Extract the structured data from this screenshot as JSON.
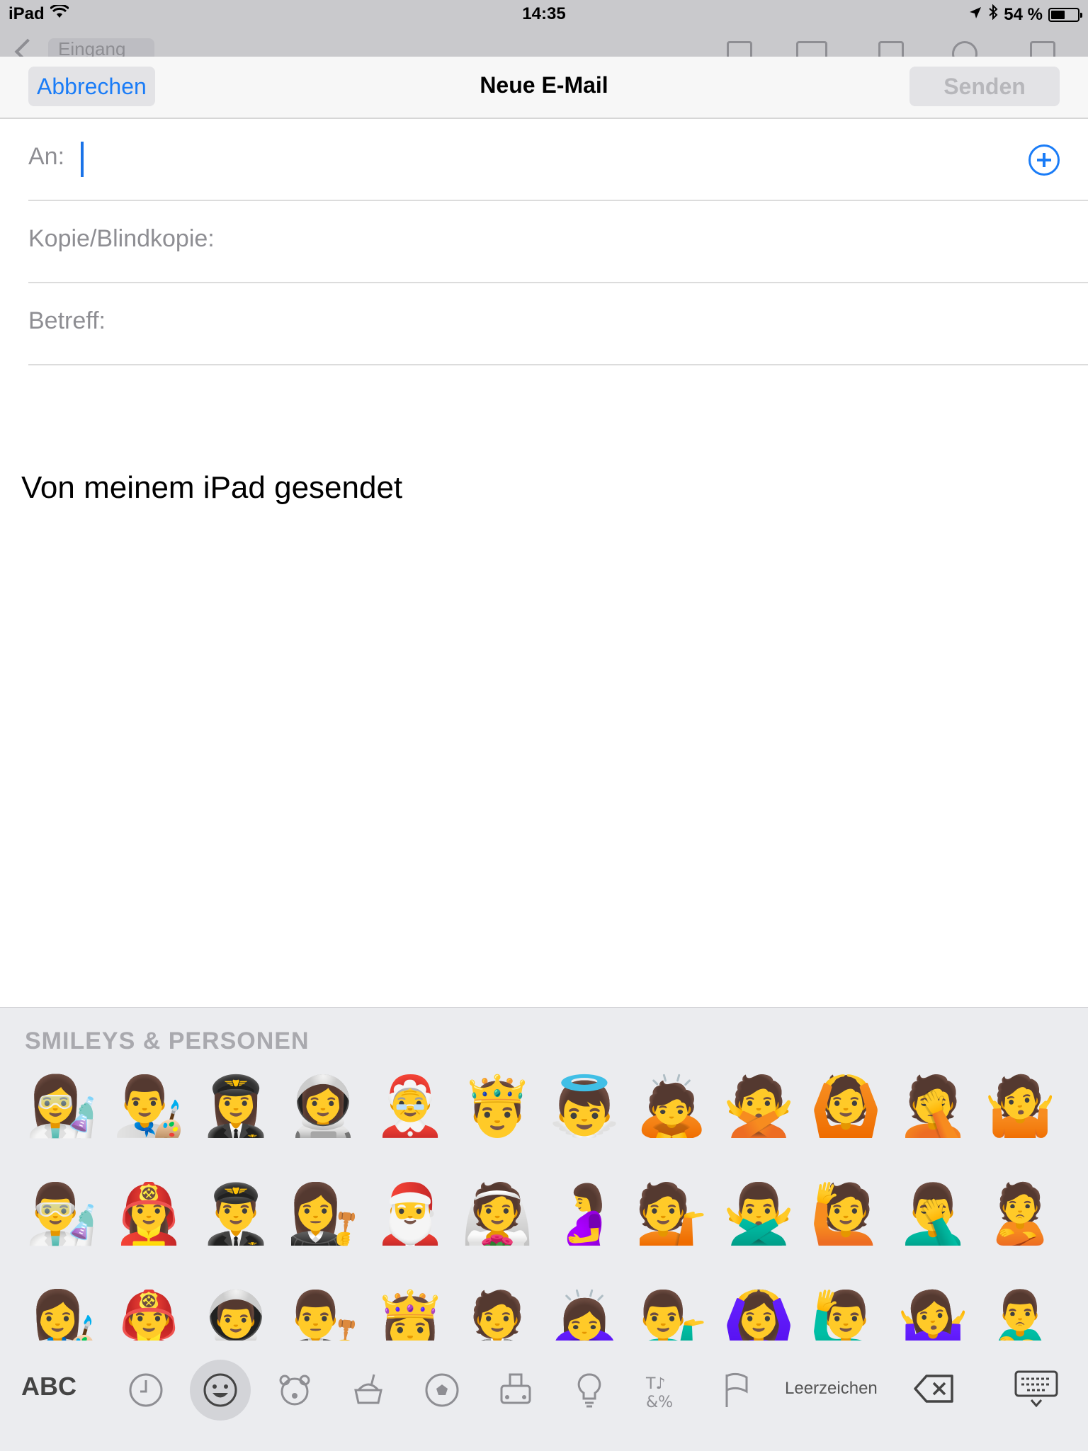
{
  "status_bar": {
    "device": "iPad",
    "time": "14:35",
    "battery": "54 %",
    "battery_level": 0.54
  },
  "background_toolbar": {
    "back_label": "Eingang"
  },
  "compose": {
    "cancel_label": "Abbrechen",
    "title": "Neue E-Mail",
    "send_label": "Senden",
    "to_label": "An:",
    "cc_label": "Kopie/Blindkopie:",
    "subject_label": "Betreff:",
    "signature": "Von meinem iPad gesendet"
  },
  "keyboard": {
    "category_title": "SMILEYS & PERSONEN",
    "abc_label": "ABC",
    "space_label": "Leerzeichen",
    "emoji_rows": [
      [
        "👩‍🔬",
        "👨‍🎨",
        "👩‍✈️",
        "👩‍🚀",
        "🤶",
        "🤴",
        "👼",
        "🙇",
        "🙅",
        "🙆",
        "🤦",
        "🤷"
      ],
      [
        "👨‍🔬",
        "👩‍🚒",
        "👨‍✈️",
        "👩‍⚖️",
        "🎅",
        "👰",
        "🤰",
        "💁",
        "🙅‍♂️",
        "🙋",
        "🤦‍♂️",
        "🙎"
      ],
      [
        "👩‍🎨",
        "👨‍🚒",
        "👨‍🚀",
        "👨‍⚖️",
        "👸",
        "🤵",
        "🙇‍♀️",
        "💁‍♂️",
        "🙆‍♀️",
        "🙋‍♂️",
        "🤷‍♀️",
        "🙎‍♂️"
      ]
    ],
    "categories": [
      "recent-icon",
      "smileys-icon",
      "animals-icon",
      "food-icon",
      "activity-icon",
      "travel-icon",
      "objects-icon",
      "symbols-icon",
      "flags-icon"
    ]
  }
}
